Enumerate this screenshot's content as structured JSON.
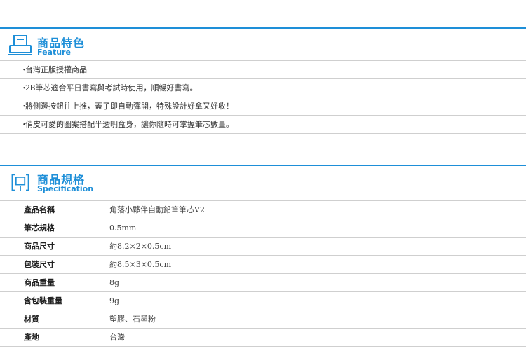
{
  "feature": {
    "title_zh": "商品特色",
    "title_en": "Feature",
    "icon": "printer-icon",
    "items": [
      {
        "bullet": "・",
        "text": "台灣正版授權商品"
      },
      {
        "bullet": "・",
        "text": "2B筆芯適合平日書寫與考試時使用，順暢好書寫。"
      },
      {
        "bullet": "・",
        "text": "將側邊按鈕往上推，蓋子即自動彈開，特殊設計好拿又好收！"
      },
      {
        "bullet": "・",
        "text": "俏皮可愛的圖案搭配半透明盒身，讓你隨時可掌握筆芯數量。"
      }
    ]
  },
  "specification": {
    "title_zh": "商品規格",
    "title_en": "Specification",
    "icon": "device-icon",
    "rows": [
      {
        "label": "產品名稱",
        "value": "角落小夥伴自動鉛筆筆芯V2"
      },
      {
        "label": "筆芯規格",
        "value": "0.5mm"
      },
      {
        "label": "商品尺寸",
        "value": "約8.2×2×0.5cm"
      },
      {
        "label": "包裝尺寸",
        "value": "約8.5×3×0.5cm"
      },
      {
        "label": "商品重量",
        "value": "8g"
      },
      {
        "label": "含包裝重量",
        "value": "9g"
      },
      {
        "label": "材質",
        "value": "塑膠、石墨粉"
      },
      {
        "label": "產地",
        "value": "台灣"
      }
    ]
  },
  "colors": {
    "accent": "#1e8fd8",
    "divider": "#cfcfcf"
  }
}
